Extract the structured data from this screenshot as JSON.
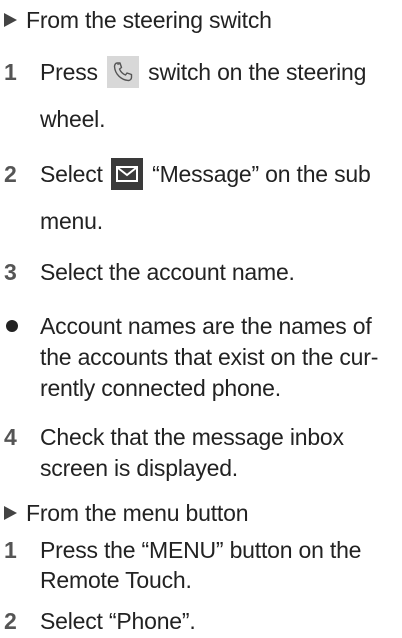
{
  "sections": [
    {
      "heading": "From the steering switch",
      "steps": [
        {
          "number": "1",
          "line1_before": "Press",
          "icon": "phone-icon",
          "line1_after": "switch on the steering",
          "line2": "wheel."
        },
        {
          "number": "2",
          "line1_before": "Select",
          "icon": "message-envelope-icon",
          "line1_after": "“Message” on the sub",
          "line2": "menu."
        },
        {
          "number": "3",
          "line1": "Select the account name."
        }
      ],
      "note": {
        "line1": "Account names are the names of",
        "line2": "the accounts that exist on the cur-",
        "line3": "rently connected phone."
      },
      "step4": {
        "number": "4",
        "line1": "Check that the message inbox",
        "line2": "screen is displayed."
      }
    },
    {
      "heading": "From the menu button",
      "steps": [
        {
          "number": "1",
          "line1": "Press the “MENU” button on the",
          "line2": "Remote Touch."
        },
        {
          "number": "2",
          "line1": "Select “Phone”."
        }
      ]
    }
  ]
}
